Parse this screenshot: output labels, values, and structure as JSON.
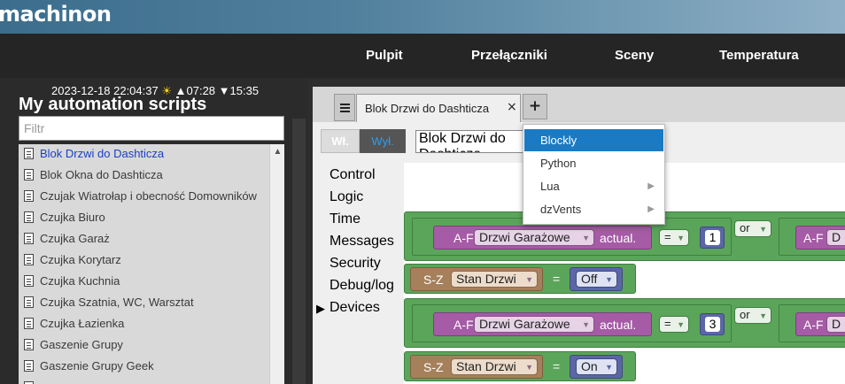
{
  "app": {
    "logo": "machinon"
  },
  "nav": {
    "items": [
      "Pulpit",
      "Przełączniki",
      "Sceny",
      "Temperatura"
    ]
  },
  "status": {
    "datetime": "2023-12-18 22:04:37",
    "sunrise": "▲07:28",
    "sunset": "▼15:35"
  },
  "scripts": {
    "title": "My automation scripts",
    "filter_placeholder": "Filtr",
    "items": [
      "Blok Drzwi do Dashticza",
      "Blok Okna do Dashticza",
      "Czujak Wiatrołap i obecność Domowników",
      "Czujka Biuro",
      "Czujka Garaż",
      "Czujka Korytarz",
      "Czujka Kuchnia",
      "Czujka Szatnia, WC, Warsztat",
      "Czujka Łazienka",
      "Gaszenie Grupy",
      "Gaszenie Grupy Geek",
      ""
    ],
    "active_index": 0
  },
  "editor": {
    "tab_title": "Blok Drzwi do Dashticza",
    "tab_close": "×",
    "tab_add": "+",
    "btn_on": "Wł.",
    "btn_off": "Wył.",
    "script_name": "Blok Drzwi do Dashticza",
    "categories": [
      "Control",
      "Logic",
      "Time",
      "Messages",
      "Security",
      "Debug/log",
      "Devices"
    ],
    "expanded_category": "Devices"
  },
  "blocks": {
    "row1": {
      "prefix": "A-F",
      "device": "Drzwi Garażowe",
      "prop": "actual.",
      "op": "=",
      "value": "1",
      "logic": "or",
      "prefix2": "A-F",
      "device2": "D"
    },
    "row2": {
      "prefix": "S-Z",
      "device": "Stan Drzwi",
      "op": "=",
      "state": "Off"
    },
    "row3": {
      "prefix": "A-F",
      "device": "Drzwi Garażowe",
      "prop": "actual.",
      "op": "=",
      "value": "3",
      "logic": "or",
      "prefix2": "A-F",
      "device2": "D"
    },
    "row4": {
      "prefix": "S-Z",
      "device": "Stan Drzwi",
      "op": "=",
      "state": "On"
    }
  },
  "lang_menu": {
    "items": [
      {
        "label": "Blockly",
        "selected": true,
        "submenu": false
      },
      {
        "label": "Python",
        "selected": false,
        "submenu": false
      },
      {
        "label": "Lua",
        "selected": false,
        "submenu": true
      },
      {
        "label": "dzVents",
        "selected": false,
        "submenu": true
      }
    ]
  },
  "colors": {
    "accent": "#1a7bc4",
    "logic_block": "#5ba55b",
    "device_block": "#a55ba5",
    "variable_block": "#a5805b",
    "value_block": "#5b67a5"
  },
  "icons": {
    "tab_menu": "hamburger-icon",
    "script_doc": "document-icon",
    "daytime": "sun-icon",
    "submenu": "chevron-right-icon",
    "scroll_up": "chevron-up-icon",
    "category_expand": "triangle-right-icon",
    "dropdown": "triangle-down-icon"
  }
}
